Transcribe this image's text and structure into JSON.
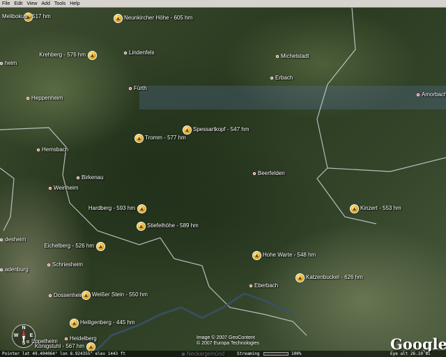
{
  "menubar": {
    "items": [
      "File",
      "Edit",
      "View",
      "Add",
      "Tools",
      "Help"
    ]
  },
  "towns": [
    {
      "name": "Lindenfels"
    },
    {
      "name": "Michelstadt"
    },
    {
      "name": "Erbach"
    },
    {
      "name": "Fürth"
    },
    {
      "name": "Amorbach"
    },
    {
      "name": "Heppenheim"
    },
    {
      "name": "Hemsbach"
    },
    {
      "name": "Birkenau"
    },
    {
      "name": "Weinheim"
    },
    {
      "name": "Beerfelden"
    },
    {
      "name": "Schriesheim"
    },
    {
      "name": "Eberbach"
    },
    {
      "name": "Dossenheim"
    },
    {
      "name": "Heidelberg"
    },
    {
      "name": "Eppelheim"
    },
    {
      "name": "Neckargemünd"
    },
    {
      "name": "heim"
    },
    {
      "name": "desheim"
    },
    {
      "name": "adenburg"
    }
  ],
  "peaks": [
    {
      "label": "Melibokus - 517 hm"
    },
    {
      "label": "Neunkircher Höhe - 605 hm"
    },
    {
      "label": "Krehberg - 576 hm"
    },
    {
      "label": "Spessartkopf - 547 hm"
    },
    {
      "label": "Tromm - 577 hm"
    },
    {
      "label": "Hardberg - 593 hm"
    },
    {
      "label": "Stiefelhöhe - 589 hm"
    },
    {
      "label": "Kinzert - 553 hm"
    },
    {
      "label": "Eichelberg - 526 hm"
    },
    {
      "label": "Hohe Warte - 548 hm"
    },
    {
      "label": "Katzenbuckel - 626 hm"
    },
    {
      "label": "Weißer Stein - 550 hm"
    },
    {
      "label": "Heiligenberg - 445 hm"
    },
    {
      "label": "Königstuhl - 567 hm"
    }
  ],
  "compass": {
    "n": "N",
    "w": "W",
    "e": "E",
    "s": "S"
  },
  "credits": {
    "line1": "Image © 2007 GeoContent",
    "line2": "© 2007 Europa Technologies"
  },
  "logo": "Google",
  "status": {
    "pointer": "Pointer  lat   49.494064°  lon   8.924355°   elev  1443 ft",
    "streaming": "Streaming",
    "streaming_percent": "100%",
    "streaming_progress": 1.0,
    "eye_alt": "Eye alt  26.10 mi"
  }
}
